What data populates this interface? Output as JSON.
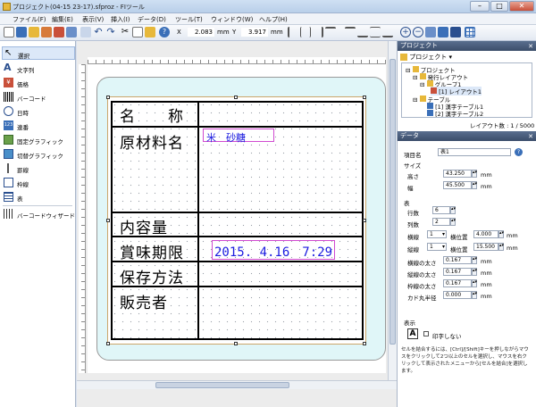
{
  "window": {
    "title": "プロジェクト(04-15 23-17).sfproz - FIツール"
  },
  "menu": [
    {
      "label": "ファイル(F)"
    },
    {
      "label": "編集(E)"
    },
    {
      "label": "表示(V)"
    },
    {
      "label": "挿入(I)"
    },
    {
      "label": "データ(D)"
    },
    {
      "label": "ツール(T)"
    },
    {
      "label": "ウィンドウ(W)"
    },
    {
      "label": "ヘルプ(H)"
    }
  ],
  "toolbar": {
    "x_label": "X",
    "x_value": "2.083",
    "x_unit": "mm",
    "y_label": "Y",
    "y_value": "3.917",
    "y_unit": "mm"
  },
  "tools": [
    {
      "label": "選択",
      "icon": "arrow-icon"
    },
    {
      "label": "文字列",
      "icon": "text-icon"
    },
    {
      "label": "価格",
      "icon": "price-icon"
    },
    {
      "label": "バーコード",
      "icon": "barcode-icon"
    },
    {
      "label": "日時",
      "icon": "clock-icon"
    },
    {
      "label": "連番",
      "icon": "sequence-icon"
    },
    {
      "label": "固定グラフィック",
      "icon": "fixed-graphic-icon"
    },
    {
      "label": "切替グラフィック",
      "icon": "switch-graphic-icon"
    },
    {
      "label": "罫線",
      "icon": "line-icon"
    },
    {
      "label": "枠線",
      "icon": "frame-icon"
    },
    {
      "label": "表",
      "icon": "table-icon"
    },
    {
      "label": "バーコードウィザード",
      "icon": "barcode-wizard-icon"
    }
  ],
  "label_table": {
    "rows": [
      {
        "title": "名　　称",
        "value": ""
      },
      {
        "title": "原材料名",
        "value": "米　砂糖"
      },
      {
        "title": "内容量",
        "value": ""
      },
      {
        "title": "賞味期限",
        "value": "2015. 4.16　7:29"
      },
      {
        "title": "保存方法",
        "value": ""
      },
      {
        "title": "販売者",
        "value": ""
      }
    ]
  },
  "project_panel": {
    "title": "プロジェクト",
    "dropdown": "プロジェクト",
    "tree": [
      {
        "label": "プロジェクト"
      },
      {
        "label": "発行レイアウト"
      },
      {
        "label": "グループ1"
      },
      {
        "label": "[1] レイアウト1"
      },
      {
        "label": "テーブル"
      },
      {
        "label": "[1] 漢字テーブル1"
      },
      {
        "label": "[2] 漢字テーブル2"
      }
    ],
    "layout_count": "レイアウト数 : 1 / 5000"
  },
  "data_panel": {
    "title": "データ",
    "item_name_label": "項目名",
    "item_name_value": "表1",
    "size_label": "サイズ",
    "height_label": "高さ",
    "height_value": "43.250",
    "width_label": "幅",
    "width_value": "45.500",
    "unit": "mm",
    "table_label": "表",
    "rows_label": "行数",
    "rows_value": "6",
    "cols_label": "列数",
    "cols_value": "2",
    "hline_label": "横線",
    "hline_value": "1",
    "hpos_label": "横位置",
    "hpos_value": "4.000",
    "vline_label": "縦線",
    "vline_value": "1",
    "vpos_label": "横位置",
    "vpos_value": "15.500",
    "hthick_label": "横線の太さ",
    "hthick_value": "0.167",
    "vthick_label": "縦線の太さ",
    "vthick_value": "0.167",
    "fthick_label": "枠線の太さ",
    "fthick_value": "0.167",
    "radius_label": "カド丸半径",
    "radius_value": "0.000",
    "display_label": "表示",
    "noprint_label": "印字しない",
    "help_text": "セルを結合するには、[Ctrl]/[Shift]キーを押しながらマウスをクリックして2つ以上のセルを選択し、マウスを右クリックして表示されたメニューから[セルを結合]を選択します。"
  },
  "colors": {
    "accent_blue": "#1c1ce0",
    "selection_magenta": "#d04ad0",
    "label_bg": "#e0f6f8"
  }
}
